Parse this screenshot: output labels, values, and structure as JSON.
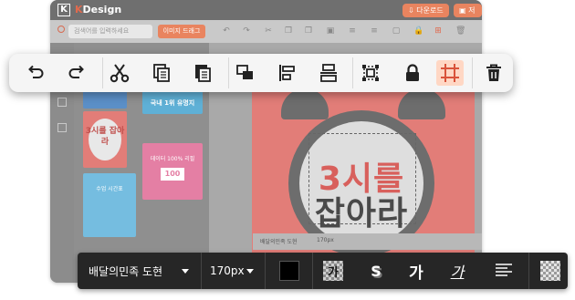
{
  "app": {
    "logo_letter": "K",
    "title_accent": "K",
    "title_rest": "Design",
    "download_label": "다운로드",
    "save_label": "저장"
  },
  "subbar": {
    "search_placeholder": "검색어를 입력하세요",
    "image_button_label": "이미지 드래그"
  },
  "poster": {
    "line1": "3시를",
    "line2": "잡아라"
  },
  "mini_fontbar": {
    "font_name": "배달의민족 도현",
    "size": "170px"
  },
  "thumbnails": [
    {
      "text": "",
      "bg": "#5b8fc7"
    },
    {
      "text": "국내 1위 유명지",
      "bg": "#5fb0d6"
    },
    {
      "text": "3시를 잡아라",
      "bg": "#e27d78"
    },
    {
      "text": "데이터 100% 리필",
      "bg": "#e47fa4"
    },
    {
      "text": "수업 시간표",
      "bg": "#75bde0"
    }
  ],
  "floating_toolbar": {
    "buttons": [
      {
        "name": "undo-button",
        "icon": "undo-icon"
      },
      {
        "name": "redo-button",
        "icon": "redo-icon"
      },
      {
        "name": "cut-button",
        "icon": "scissors-icon"
      },
      {
        "name": "copy-button",
        "icon": "copy-icon"
      },
      {
        "name": "paste-button",
        "icon": "paste-icon"
      },
      {
        "name": "group-button",
        "icon": "group-icon"
      },
      {
        "name": "align-left-button",
        "icon": "align-left-icon"
      },
      {
        "name": "align-center-button",
        "icon": "align-center-icon"
      },
      {
        "name": "fit-button",
        "icon": "fit-icon"
      },
      {
        "name": "lock-button",
        "icon": "lock-icon"
      },
      {
        "name": "crop-button",
        "icon": "crop-icon",
        "active": true
      },
      {
        "name": "delete-button",
        "icon": "trash-icon"
      }
    ]
  },
  "font_toolbar": {
    "font_name": "배달의민족 도현",
    "font_size": "170px",
    "color": "#000000",
    "btn_outline": "가",
    "btn_shadow": "S",
    "btn_bold": "가",
    "btn_underline": "가"
  },
  "colors": {
    "accent": "#e9845f",
    "active_bg": "#ffd7c4",
    "poster_bg": "#e27d78"
  }
}
